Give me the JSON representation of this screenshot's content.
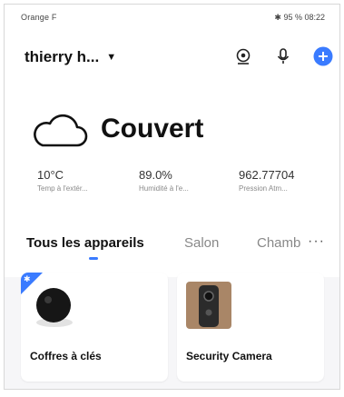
{
  "status_bar": {
    "left_text": "Orange F",
    "battery": "95 %",
    "time": "08:22"
  },
  "header": {
    "home_name": "thierry h...",
    "icons": [
      "camera-icon",
      "microphone-icon",
      "add-icon"
    ]
  },
  "weather": {
    "icon": "cloud-icon",
    "condition": "Couvert",
    "stats": [
      {
        "value": "10°C",
        "label": "Temp à l'extér..."
      },
      {
        "value": "89.0%",
        "label": "Humidité à l'e..."
      },
      {
        "value": "962.77704",
        "label": "Pression Atm..."
      }
    ]
  },
  "tabs": [
    {
      "label": "Tous les appareils",
      "active": true
    },
    {
      "label": "Salon",
      "active": false
    },
    {
      "label": "Chamb",
      "active": false
    }
  ],
  "more_label": "···",
  "devices": [
    {
      "name": "Coffres à clés",
      "icon": "key-lockbox-icon",
      "bluetooth": true
    },
    {
      "name": "Security Camera",
      "icon": "camera-device-icon",
      "bluetooth": false
    }
  ],
  "colors": {
    "accent": "#3a7bff",
    "background": "#f6f6f8"
  }
}
